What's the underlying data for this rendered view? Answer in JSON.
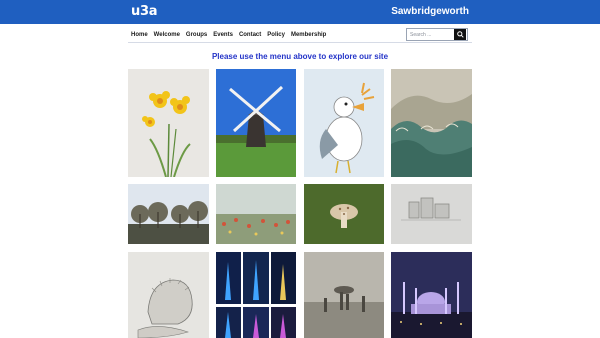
{
  "header": {
    "logo": "u3a",
    "site_name": "Sawbridgeworth"
  },
  "nav": {
    "items": [
      {
        "label": "Home",
        "active": true
      },
      {
        "label": "Welcome"
      },
      {
        "label": "Groups"
      },
      {
        "label": "Events"
      },
      {
        "label": "Contact"
      },
      {
        "label": "Policy"
      },
      {
        "label": "Membership"
      }
    ]
  },
  "search": {
    "placeholder": "Search ..."
  },
  "main": {
    "tagline": "Please use the menu above to explore our site"
  },
  "colors": {
    "header": "#1f5fc0",
    "tagline": "#2434c8"
  },
  "gallery": [
    {
      "name": "daffodils-painting"
    },
    {
      "name": "windmill-photo"
    },
    {
      "name": "seagull-painting"
    },
    {
      "name": "wave-print"
    },
    {
      "name": "winter-trees-photo"
    },
    {
      "name": "wildflower-painting"
    },
    {
      "name": "mushroom-photo"
    },
    {
      "name": "pencil-building-sketch"
    },
    {
      "name": "hedgehog-drawing"
    },
    {
      "name": "illuminated-towers-grid"
    },
    {
      "name": "rainy-street-painting"
    },
    {
      "name": "mosque-night-photo"
    }
  ]
}
